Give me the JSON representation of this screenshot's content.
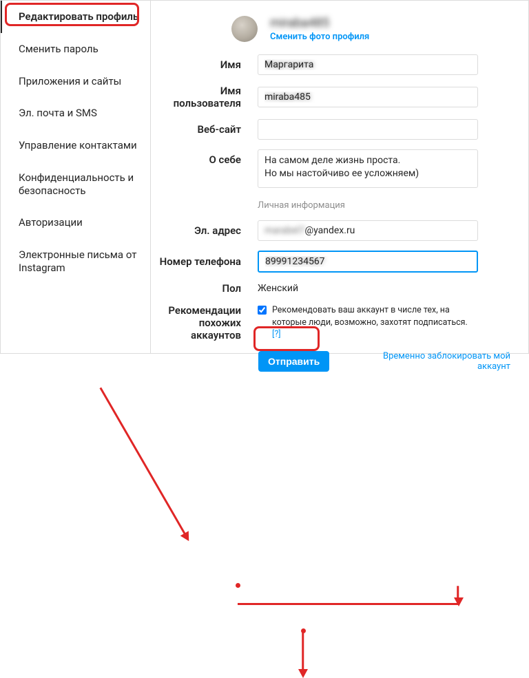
{
  "sidebar": {
    "items": [
      {
        "label": "Редактировать профиль",
        "active": true
      },
      {
        "label": "Сменить пароль"
      },
      {
        "label": "Приложения и сайты"
      },
      {
        "label": "Эл. почта и SMS"
      },
      {
        "label": "Управление контактами"
      },
      {
        "label": "Конфиденциальность и безопасность"
      },
      {
        "label": "Авторизации"
      },
      {
        "label": "Электронные письма от Instagram"
      }
    ]
  },
  "profile": {
    "username_blurred": "miraba485",
    "change_photo": "Сменить фото профиля",
    "labels": {
      "name": "Имя",
      "username": "Имя пользователя",
      "website": "Веб-сайт",
      "bio": "О себе",
      "personal_info_heading": "Личная информация",
      "email": "Эл. адрес",
      "phone": "Номер телефона",
      "gender": "Пол",
      "similar_accounts": "Рекомендации похожих аккаунтов"
    },
    "values": {
      "name_blurred": "Маргарита",
      "username_blurred": "miraba485",
      "website": "",
      "bio": "На самом деле жизнь проста.\nНо мы настойчиво ее усложняем)",
      "email_visible_suffix": "@yandex.ru",
      "email_blurred_prefix": "marabel7",
      "phone_blurred": "89991234567",
      "gender": "Женский"
    },
    "similar_accounts": {
      "checked": true,
      "text": "Рекомендовать ваш аккаунт в числе тех, на которые люди, возможно, захотят подписаться.",
      "help": "[?]"
    },
    "submit_label": "Отправить",
    "disable_link": "Временно заблокировать мой аккаунт"
  }
}
